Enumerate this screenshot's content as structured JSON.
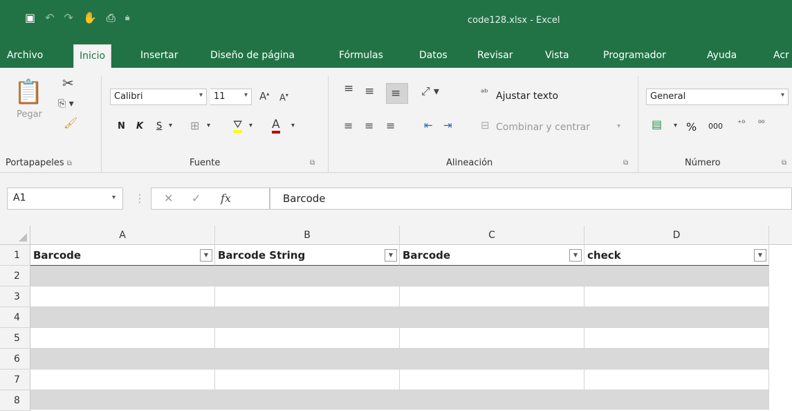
{
  "window": {
    "title": "code128.xlsx  -  Excel"
  },
  "qat": {
    "save": "🖫",
    "undo": "↶",
    "redo": "↷",
    "touch": "👆",
    "print": "🖶",
    "customize": "⚲"
  },
  "tabs": [
    "Archivo",
    "Inicio",
    "Insertar",
    "Diseño de página",
    "Fórmulas",
    "Datos",
    "Revisar",
    "Vista",
    "Programador",
    "Ayuda",
    "Acr"
  ],
  "active_tab": "Inicio",
  "ribbon": {
    "clipboard": {
      "paste": "Pegar",
      "label": "Portapapeles"
    },
    "font": {
      "name": "Calibri",
      "size": "11",
      "bold": "N",
      "italic": "K",
      "underline": "S",
      "label": "Fuente"
    },
    "alignment": {
      "wrap": "Ajustar texto",
      "merge": "Combinar y centrar",
      "label": "Alineación"
    },
    "number": {
      "format": "General",
      "percent": "%",
      "thousands": "000",
      "label": "Número"
    }
  },
  "formula_bar": {
    "name_box": "A1",
    "formula": "Barcode",
    "fx": "fx"
  },
  "columns": [
    "A",
    "B",
    "C",
    "D"
  ],
  "rows": [
    "1",
    "2",
    "3",
    "4",
    "5",
    "6",
    "7",
    "8"
  ],
  "headers": [
    "Barcode",
    "Barcode String",
    "Barcode",
    "check"
  ],
  "colors": {
    "excel_green": "#217346",
    "band": "#d9d9d9"
  }
}
